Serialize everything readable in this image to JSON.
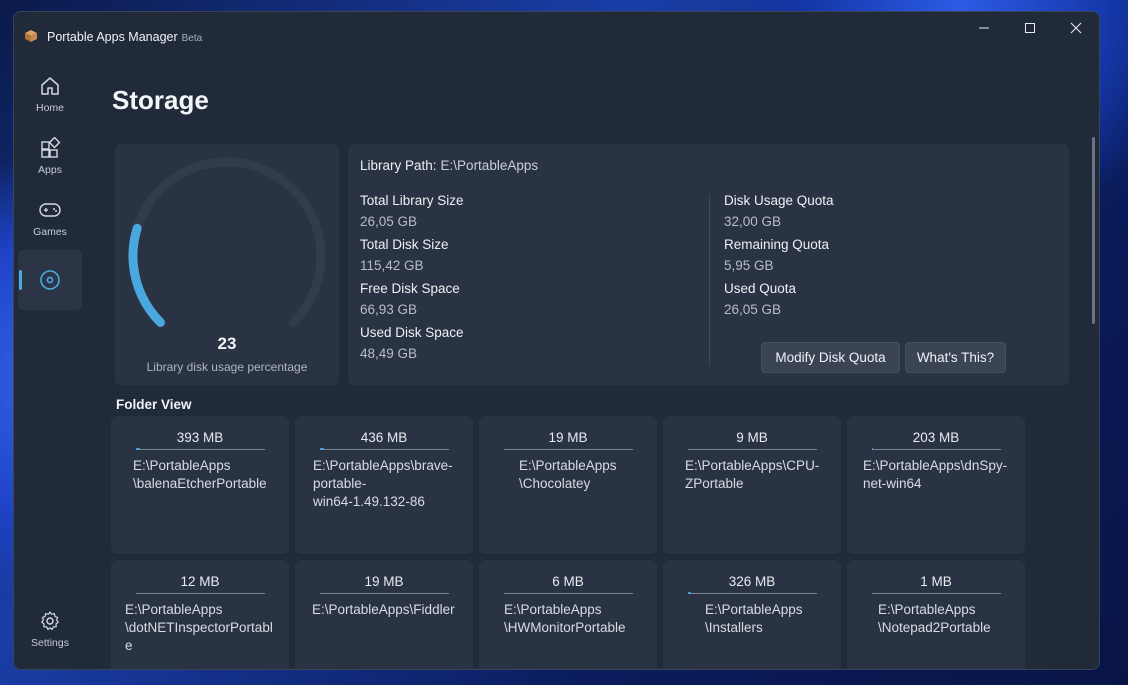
{
  "app": {
    "title": "Portable Apps Manager",
    "badge": "Beta"
  },
  "window_controls": {
    "minimize_icon": "minimize-icon",
    "maximize_icon": "maximize-icon",
    "close_icon": "close-icon"
  },
  "nav": {
    "items": [
      {
        "label": "Home",
        "icon": "home-icon"
      },
      {
        "label": "Apps",
        "icon": "apps-icon"
      },
      {
        "label": "Games",
        "icon": "gamepad-icon"
      },
      {
        "label": "",
        "icon": "storage-disc-icon",
        "active": true
      }
    ],
    "settings": {
      "label": "Settings",
      "icon": "gear-icon"
    }
  },
  "page": {
    "title": "Storage"
  },
  "gauge": {
    "value": "23",
    "percent": 23,
    "label": "Library disk usage percentage",
    "color": "#4aa8e0"
  },
  "library": {
    "path_label": "Library Path:",
    "path_value": "E:\\PortableApps",
    "left": [
      {
        "label": "Total Library Size",
        "value": "26,05 GB"
      },
      {
        "label": "Total Disk Size",
        "value": "115,42 GB"
      },
      {
        "label": "Free Disk Space",
        "value": "66,93 GB"
      },
      {
        "label": "Used Disk Space",
        "value": "48,49 GB"
      }
    ],
    "right": [
      {
        "label": "Disk Usage Quota",
        "value": "32,00 GB"
      },
      {
        "label": "Remaining Quota",
        "value": "5,95 GB"
      },
      {
        "label": "Used Quota",
        "value": "26,05 GB"
      }
    ],
    "buttons": {
      "modify": "Modify Disk Quota",
      "whats_this": "What's This?"
    }
  },
  "folder_view": {
    "title": "Folder View",
    "tiles": [
      {
        "size": "393 MB",
        "path": "E:\\PortableApps\n\\balenaEtcherPortable",
        "fill": 0.03
      },
      {
        "size": "436 MB",
        "path": "E:\\PortableApps\\brave-\nportable-\nwin64-1.49.132-86",
        "fill": 0.03
      },
      {
        "size": "19 MB",
        "path": "E:\\PortableApps\n\\Chocolatey",
        "fill": 0
      },
      {
        "size": "9 MB",
        "path": "E:\\PortableApps\\CPU-\nZPortable",
        "fill": 0
      },
      {
        "size": "203 MB",
        "path": "E:\\PortableApps\\dnSpy-\nnet-win64",
        "fill": 0.01
      },
      {
        "size": "12 MB",
        "path": "E:\\PortableApps\n\\dotNETInspectorPortabl\ne",
        "fill": 0
      },
      {
        "size": "19 MB",
        "path": "E:\\PortableApps\\Fiddler",
        "fill": 0
      },
      {
        "size": "6 MB",
        "path": "E:\\PortableApps\n\\HWMonitorPortable",
        "fill": 0
      },
      {
        "size": "326 MB",
        "path": "E:\\PortableApps\n\\Installers",
        "fill": 0.02
      },
      {
        "size": "1 MB",
        "path": "E:\\PortableApps\n\\Notepad2Portable",
        "fill": 0
      }
    ]
  }
}
